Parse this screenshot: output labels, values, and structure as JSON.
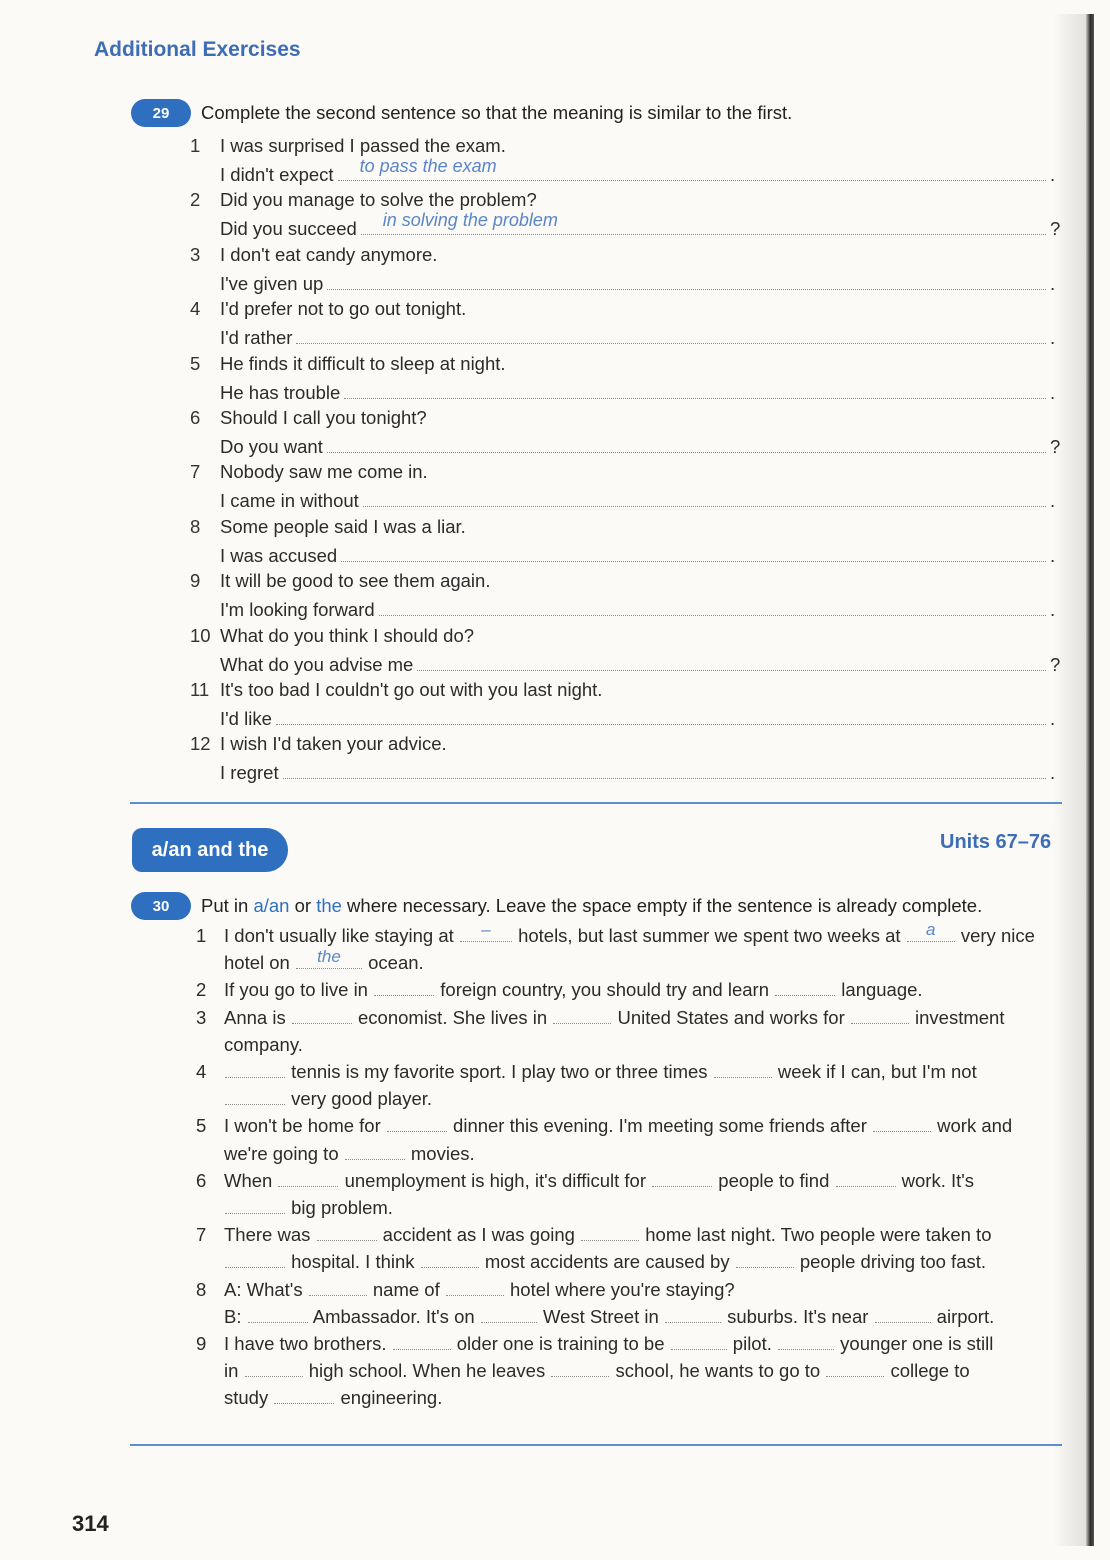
{
  "heading": "Additional Exercises",
  "ex29": {
    "number": "29",
    "instruction": "Complete the second sentence so that the meaning is similar to the first.",
    "items": [
      {
        "n": "1",
        "q": "I was surprised I passed the exam.",
        "prompt": "I didn't expect",
        "answer": "to pass the exam",
        "end": "."
      },
      {
        "n": "2",
        "q": "Did you manage to solve the problem?",
        "prompt": "Did you succeed",
        "answer": "in solving the problem",
        "end": "?"
      },
      {
        "n": "3",
        "q": "I don't eat candy anymore.",
        "prompt": "I've given up",
        "answer": "",
        "end": "."
      },
      {
        "n": "4",
        "q": "I'd prefer not to go out tonight.",
        "prompt": "I'd rather",
        "answer": "",
        "end": "."
      },
      {
        "n": "5",
        "q": "He finds it difficult to sleep at night.",
        "prompt": "He has trouble",
        "answer": "",
        "end": "."
      },
      {
        "n": "6",
        "q": "Should I call you tonight?",
        "prompt": "Do you want",
        "answer": "",
        "end": "?"
      },
      {
        "n": "7",
        "q": "Nobody saw me come in.",
        "prompt": "I came in without",
        "answer": "",
        "end": "."
      },
      {
        "n": "8",
        "q": "Some people said I was a liar.",
        "prompt": "I was accused",
        "answer": "",
        "end": "."
      },
      {
        "n": "9",
        "q": "It will be good to see them again.",
        "prompt": "I'm looking forward",
        "answer": "",
        "end": "."
      },
      {
        "n": "10",
        "q": "What do you think I should do?",
        "prompt": "What do you advise me",
        "answer": "",
        "end": "?"
      },
      {
        "n": "11",
        "q": "It's too bad I couldn't go out with you last night.",
        "prompt": "I'd like",
        "answer": "",
        "end": "."
      },
      {
        "n": "12",
        "q": "I wish I'd taken your advice.",
        "prompt": "I regret",
        "answer": "",
        "end": "."
      }
    ]
  },
  "section": {
    "title": "a/an and the",
    "units": "Units 67–76"
  },
  "ex30": {
    "number": "30",
    "instruction_parts": [
      "Put in ",
      "a/an",
      " or ",
      "the",
      " where necessary.  Leave the space empty if the sentence is already complete."
    ],
    "answers": {
      "a1": "–",
      "a2": "a",
      "a3": "the"
    },
    "text": {
      "s1a": "I don't usually like staying at",
      "s1b": "hotels, but last summer we spent two weeks at",
      "s1c": "very nice",
      "s1d": "hotel on",
      "s1e": "ocean.",
      "s2a": "If you go to live in",
      "s2b": "foreign country, you should try and learn",
      "s2c": "language.",
      "s3a": "Anna is",
      "s3b": "economist.  She lives in",
      "s3c": "United States and works for",
      "s3d": "investment",
      "s3e": "company.",
      "s4a": "tennis is my favorite sport.  I play two or three times",
      "s4b": "week if I can, but I'm not",
      "s4c": "very good player.",
      "s5a": "I won't be home for",
      "s5b": "dinner this evening.  I'm meeting some friends after",
      "s5c": "work and",
      "s5d": "we're going to",
      "s5e": "movies.",
      "s6a": "When",
      "s6b": "unemployment is high, it's difficult for",
      "s6c": "people to find",
      "s6d": "work.  It's",
      "s6e": "big problem.",
      "s7a": "There was",
      "s7b": "accident as I was going",
      "s7c": "home last night.  Two people were taken to",
      "s7d": "hospital.  I think",
      "s7e": "most accidents are caused by",
      "s7f": "people driving too fast.",
      "s8A": "A:",
      "s8a": "What's",
      "s8b": "name of",
      "s8c": "hotel where you're staying?",
      "s8B": "B:",
      "s8d": "Ambassador.  It's on",
      "s8e": "West Street in",
      "s8f": "suburbs.  It's near",
      "s8g": "airport.",
      "s9a": "I have two brothers.",
      "s9b": "older one is training to be",
      "s9c": "pilot.",
      "s9d": "younger one is still",
      "s9e": "in",
      "s9f": "high school.  When he leaves",
      "s9g": "school, he wants to go to",
      "s9h": "college to",
      "s9i": "study",
      "s9j": "engineering."
    }
  },
  "page_number": "314",
  "colors": {
    "accent": "#2f6fc0",
    "heading": "#3d6db5",
    "handwriting": "#5a86c8"
  }
}
